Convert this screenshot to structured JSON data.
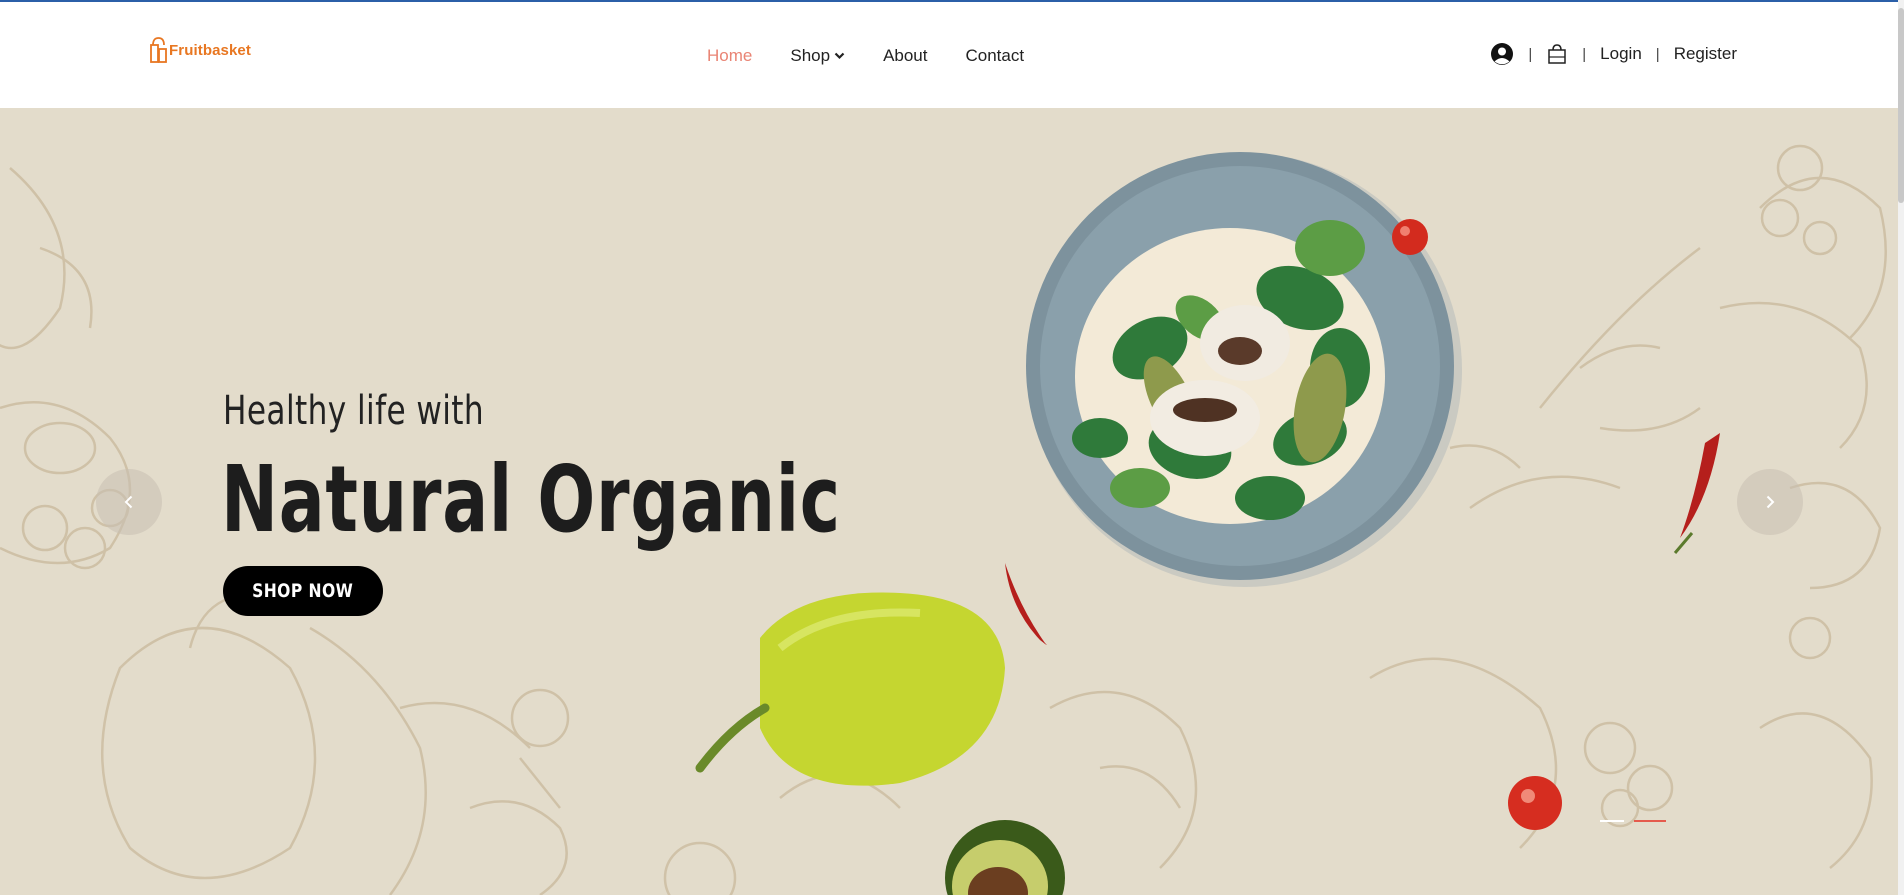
{
  "brand": {
    "name": "Fruitbasket",
    "color": "#e87722"
  },
  "nav": {
    "items": [
      {
        "label": "Home",
        "active": true
      },
      {
        "label": "Shop",
        "dropdown": true
      },
      {
        "label": "About"
      },
      {
        "label": "Contact"
      }
    ],
    "active_color": "#e98474"
  },
  "account": {
    "user_icon": "user-circle-icon",
    "cart_icon": "shopping-bag-icon",
    "separator": "|",
    "login_label": "Login",
    "register_label": "Register"
  },
  "hero": {
    "subtitle": "Healthy life with",
    "title": "Natural Organic",
    "cta_label": "SHOP NOW",
    "background_color": "#e3dccb",
    "prev_icon": "chevron-left-icon",
    "next_icon": "chevron-right-icon",
    "slides": 2,
    "active_slide": 2
  }
}
